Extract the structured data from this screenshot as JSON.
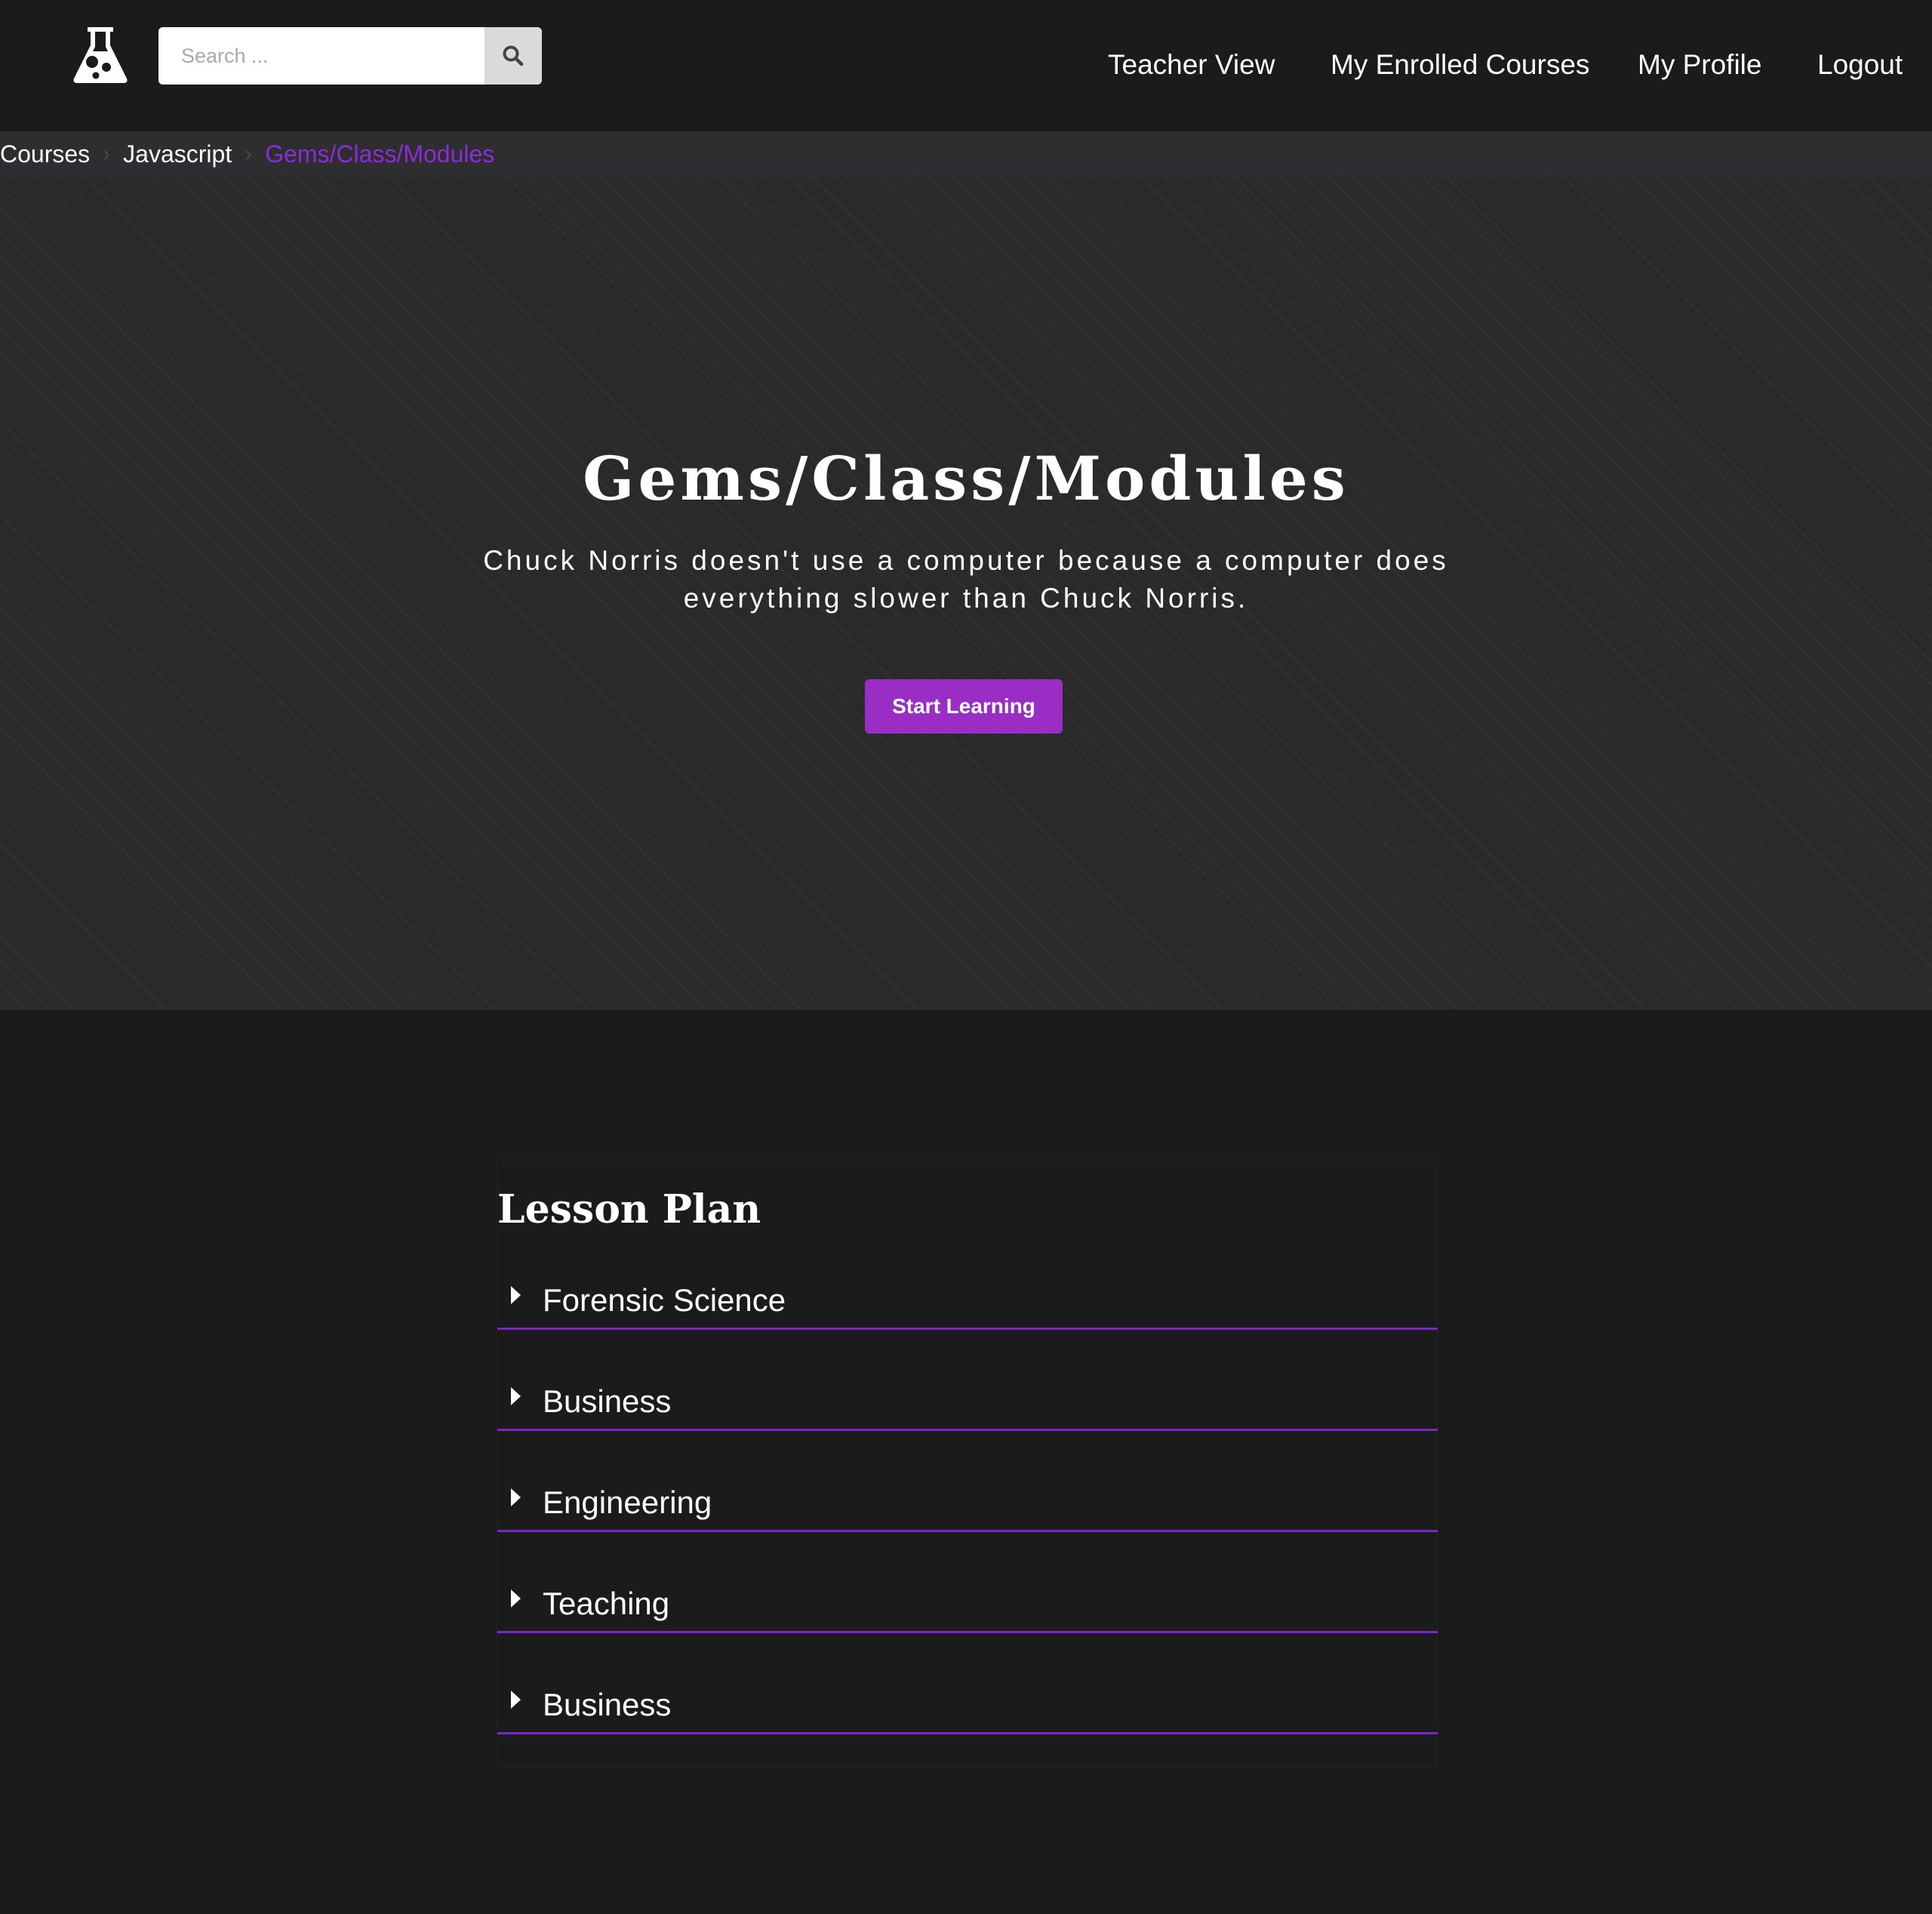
{
  "header": {
    "logo_icon": "flask-icon",
    "search": {
      "placeholder": "Search ...",
      "value": "",
      "button_icon": "search-icon"
    },
    "nav": [
      {
        "label": "Teacher View"
      },
      {
        "label": "My Enrolled Courses"
      },
      {
        "label": "My Profile"
      },
      {
        "label": "Logout"
      }
    ]
  },
  "breadcrumb": {
    "items": [
      "Courses",
      "Javascript",
      "Gems/Class/Modules"
    ],
    "separator_icon": "chevron-right-icon"
  },
  "hero": {
    "title": "Gems/Class/Modules",
    "subtitle": "Chuck Norris doesn't use a computer because a computer does everything slower than Chuck Norris.",
    "cta_label": "Start Learning"
  },
  "lesson_plan": {
    "title": "Lesson Plan",
    "items": [
      {
        "label": "Forensic Science"
      },
      {
        "label": "Business"
      },
      {
        "label": "Engineering"
      },
      {
        "label": "Teaching"
      },
      {
        "label": "Business"
      }
    ]
  },
  "colors": {
    "accent": "#9a2ec4",
    "breadcrumb_active": "#8c2bd9",
    "divider": "#7a26c9",
    "background": "#1b1b1c",
    "hero_background": "#2a2a2b"
  }
}
